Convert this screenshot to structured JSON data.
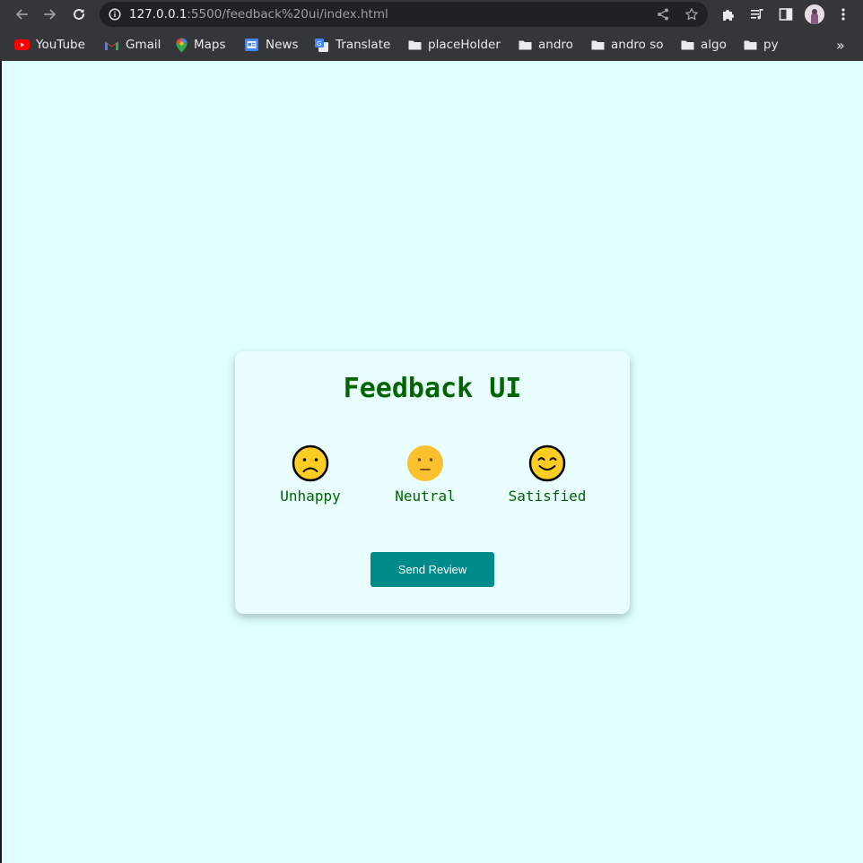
{
  "browser": {
    "url_host": "127.0.0.1",
    "url_path": ":5500/feedback%20ui/index.html",
    "bookmarks": [
      {
        "label": "YouTube",
        "icon": "youtube-icon"
      },
      {
        "label": "Gmail",
        "icon": "gmail-icon"
      },
      {
        "label": "Maps",
        "icon": "maps-icon"
      },
      {
        "label": "News",
        "icon": "news-icon"
      },
      {
        "label": "Translate",
        "icon": "translate-icon"
      },
      {
        "label": "placeHolder",
        "icon": "folder-icon"
      },
      {
        "label": "andro",
        "icon": "folder-icon"
      },
      {
        "label": "andro so",
        "icon": "folder-icon"
      },
      {
        "label": "algo",
        "icon": "folder-icon"
      },
      {
        "label": "py",
        "icon": "folder-icon"
      }
    ],
    "overflow_label": "»"
  },
  "feedback": {
    "title": "Feedback UI",
    "ratings": [
      {
        "label": "Unhappy",
        "icon": "unhappy-emoji-icon"
      },
      {
        "label": "Neutral",
        "icon": "neutral-emoji-icon"
      },
      {
        "label": "Satisfied",
        "icon": "satisfied-emoji-icon"
      }
    ],
    "button_label": "Send Review"
  },
  "colors": {
    "page_background": "#e0ffff",
    "title": "#006400",
    "button": "#008b8b",
    "emoji_fill": "#ffcc22"
  }
}
